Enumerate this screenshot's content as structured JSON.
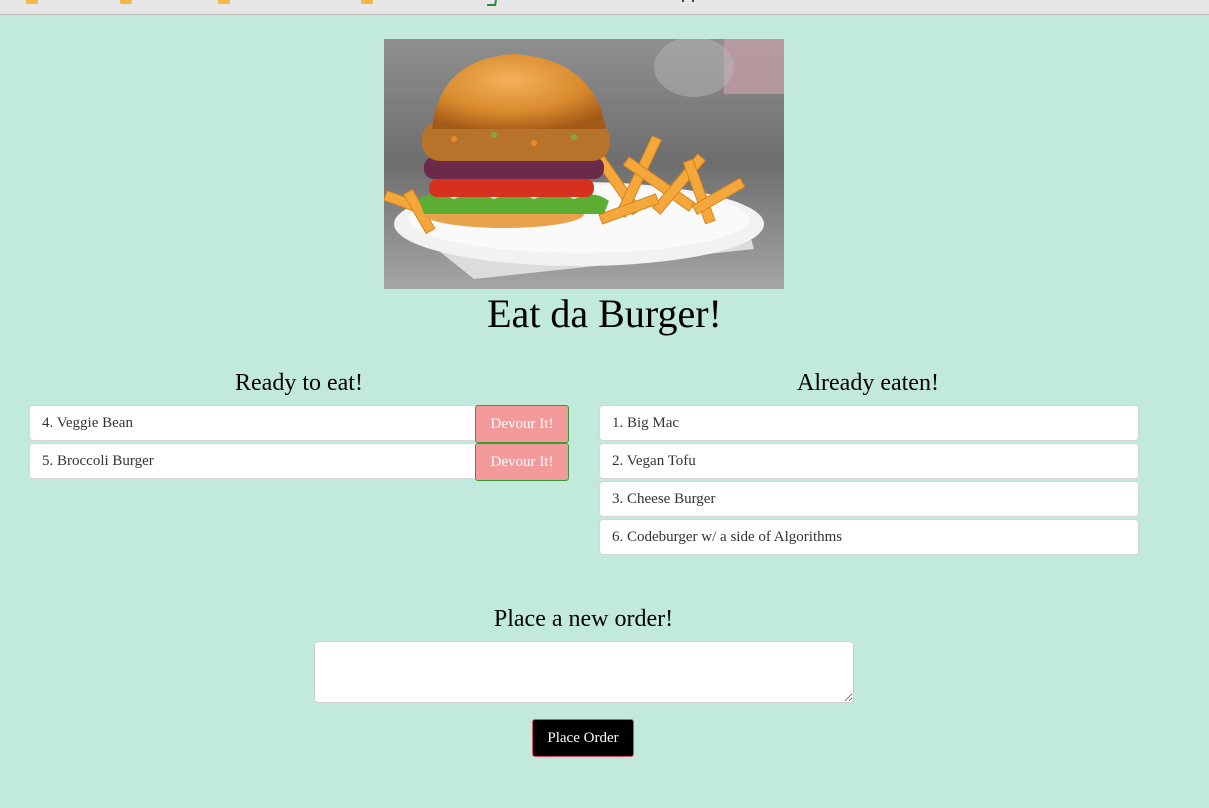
{
  "page": {
    "title": "Eat da Burger!"
  },
  "hero_image": {
    "icon": "burger-with-fries-photo"
  },
  "ready_section": {
    "heading": "Ready to eat!",
    "items": [
      {
        "label": "4. Veggie Bean",
        "button": "Devour It!"
      },
      {
        "label": "5. Broccoli Burger",
        "button": "Devour It!"
      }
    ]
  },
  "eaten_section": {
    "heading": "Already eaten!",
    "items": [
      {
        "label": "1. Big Mac"
      },
      {
        "label": "2. Vegan Tofu"
      },
      {
        "label": "3. Cheese Burger"
      },
      {
        "label": "6. Codeburger w/ a side of Algorithms"
      }
    ]
  },
  "order_form": {
    "heading": "Place a new order!",
    "input_value": "",
    "submit_label": "Place Order"
  },
  "colors": {
    "background": "#c2eadc",
    "devour_button": "#f39a9a",
    "place_order_button": "#000000"
  }
}
